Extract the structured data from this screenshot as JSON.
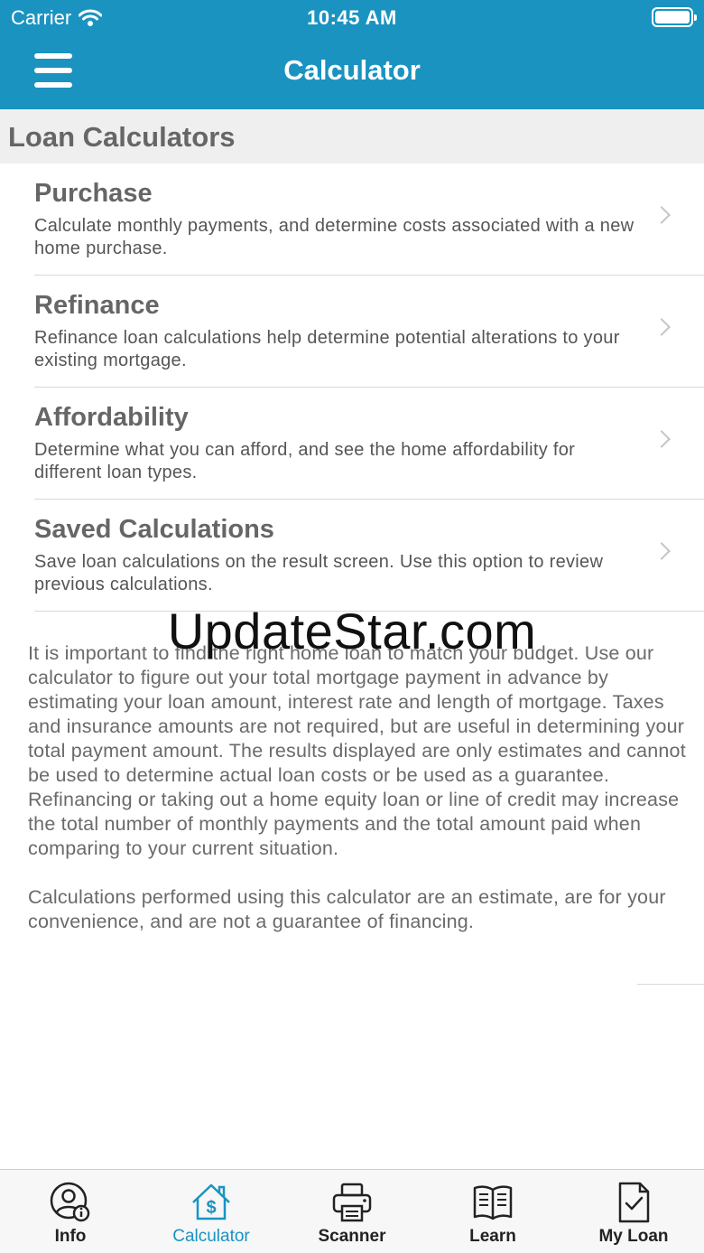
{
  "status_bar": {
    "carrier": "Carrier",
    "time": "10:45 AM"
  },
  "nav": {
    "title": "Calculator"
  },
  "section": {
    "title": "Loan Calculators"
  },
  "items": [
    {
      "title": "Purchase",
      "description": "Calculate monthly payments, and determine costs associated with a new home purchase."
    },
    {
      "title": "Refinance",
      "description": "Refinance loan calculations help determine potential alterations to your existing mortgage."
    },
    {
      "title": "Affordability",
      "description": "Determine what you can afford, and see the home affordability for different loan types."
    },
    {
      "title": "Saved Calculations",
      "description": "Save loan calculations on the result screen. Use this option to review previous calculations."
    }
  ],
  "disclaimer": {
    "paragraph1": "It is important to find the right home loan to match your budget. Use our calculator to figure out your total mortgage payment in advance by estimating your loan amount, interest rate and length of mortgage. Taxes and insurance amounts are not required, but are useful in determining your total payment amount.  The results displayed are only estimates and cannot be used to determine actual loan costs or be used as a guarantee. Refinancing or taking out a home equity loan or line of credit may increase the total number of monthly payments and the total amount paid when comparing to your current situation.",
    "paragraph2": "Calculations performed using this calculator are an estimate, are for your convenience, and are not a guarantee of financing."
  },
  "watermark": "UpdateStar.com",
  "tabs": [
    {
      "label": "Info",
      "icon": "user-info-icon"
    },
    {
      "label": "Calculator",
      "icon": "house-dollar-icon"
    },
    {
      "label": "Scanner",
      "icon": "printer-icon"
    },
    {
      "label": "Learn",
      "icon": "book-icon"
    },
    {
      "label": "My Loan",
      "icon": "document-check-icon"
    }
  ],
  "colors": {
    "brand": "#1a93c1",
    "active_tab": "#1a93c1"
  }
}
